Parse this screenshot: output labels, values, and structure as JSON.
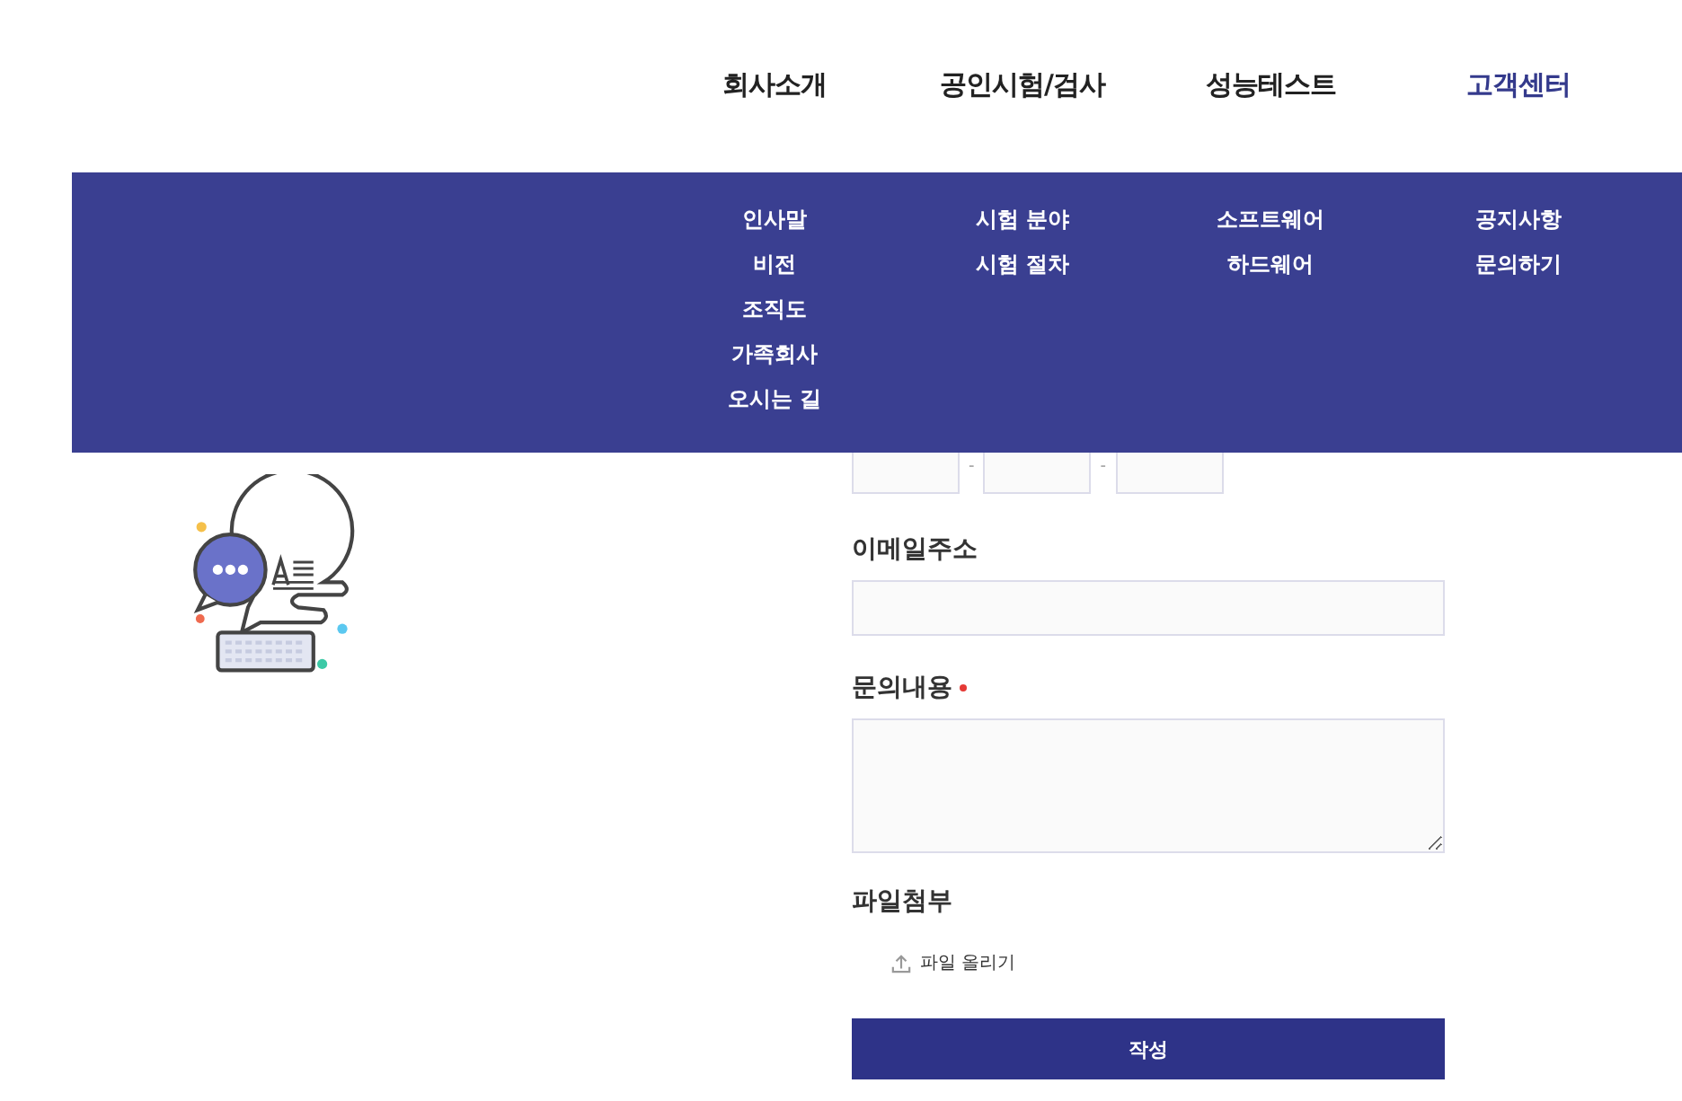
{
  "nav": [
    {
      "label": "회사소개",
      "selected": false
    },
    {
      "label": "공인시험/검사",
      "selected": false
    },
    {
      "label": "성능테스트",
      "selected": false
    },
    {
      "label": "고객센터",
      "selected": true
    }
  ],
  "mega_menu": {
    "columns": [
      [
        "인사말",
        "비전",
        "조직도",
        "가족회사",
        "오시는 길"
      ],
      [
        "시험 분야",
        "시험 절차"
      ],
      [
        "소프트웨어",
        "하드웨어"
      ],
      [
        "공지사항",
        "문의하기"
      ]
    ]
  },
  "form": {
    "fields": [
      {
        "kind": "phone",
        "separator": "-"
      },
      {
        "kind": "text",
        "label": "이메일주소",
        "required": false
      },
      {
        "kind": "textarea",
        "label": "문의내용",
        "required": true
      },
      {
        "kind": "file",
        "label": "파일첨부",
        "required": false,
        "button": "파일 올리기"
      }
    ],
    "submit": "작성"
  }
}
